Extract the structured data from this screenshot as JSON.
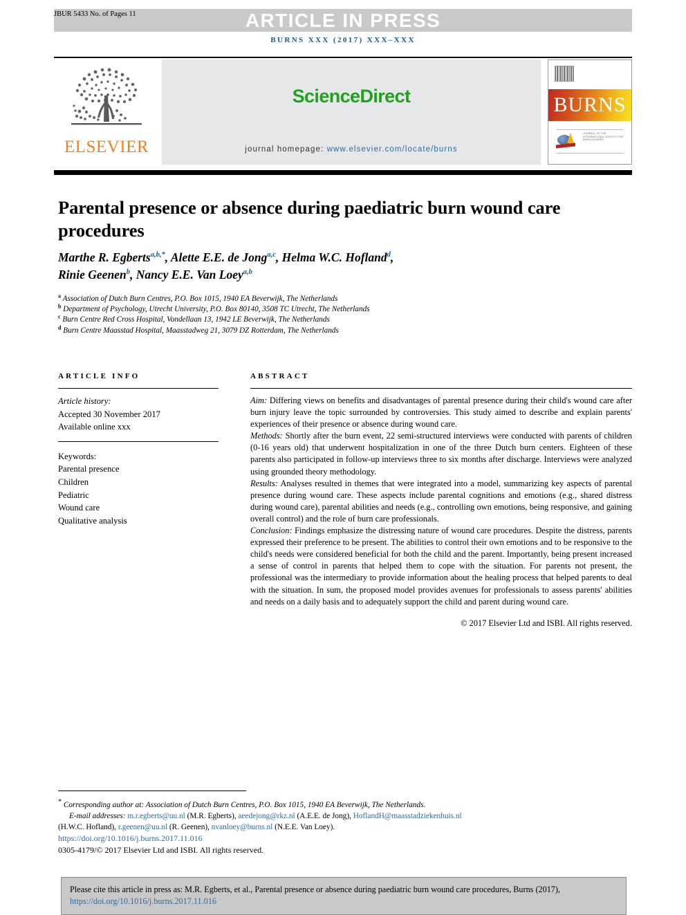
{
  "header": {
    "jbur_id": "JBUR 5433 No. of Pages 11",
    "article_in_press": "ARTICLE IN PRESS",
    "journal_volume_line": "BURNS XXX (2017) XXX–XXX",
    "publisher_name": "ELSEVIER",
    "sciencedirect": "ScienceDirect",
    "homepage_label": "journal homepage:",
    "homepage_url": "www.elsevier.com/locate/burns",
    "cover_title": "BURNS",
    "cover_society_lines": [
      "JOURNAL OF THE",
      "INTERNATIONAL SOCIETY FOR",
      "BURN INJURIES"
    ]
  },
  "article": {
    "title": "Parental presence or absence during paediatric burn wound care procedures",
    "authors": [
      {
        "name": "Marthe R. Egberts",
        "sup": "a,b,*"
      },
      {
        "name": "Alette E.E. de Jong",
        "sup": "a,c"
      },
      {
        "name": "Helma W.C. Hofland",
        "sup": "d"
      },
      {
        "name": "Rinie Geenen",
        "sup": "b"
      },
      {
        "name": "Nancy E.E. Van Loey",
        "sup": "a,b"
      }
    ],
    "affiliations": [
      {
        "marker": "a",
        "text": "Association of Dutch Burn Centres, P.O. Box 1015, 1940 EA Beverwijk, The Netherlands"
      },
      {
        "marker": "b",
        "text": "Department of Psychology, Utrecht University, P.O. Box 80140, 3508 TC Utrecht, The Netherlands"
      },
      {
        "marker": "c",
        "text": "Burn Centre Red Cross Hospital, Vondellaan 13, 1942 LE Beverwijk, The Netherlands"
      },
      {
        "marker": "d",
        "text": "Burn Centre Maasstad Hospital, Maasstadweg 21, 3079 DZ Rotterdam, The Netherlands"
      }
    ]
  },
  "article_info": {
    "heading": "ARTICLE INFO",
    "history_label": "Article history:",
    "accepted": "Accepted 30 November 2017",
    "available": "Available online xxx",
    "keywords_label": "Keywords:",
    "keywords": [
      "Parental presence",
      "Children",
      "Pediatric",
      "Wound care",
      "Qualitative analysis"
    ]
  },
  "abstract": {
    "heading": "ABSTRACT",
    "aim_label": "Aim:",
    "aim_text": " Differing views on benefits and disadvantages of parental presence during their child's wound care after burn injury leave the topic surrounded by controversies. This study aimed to describe and explain parents' experiences of their presence or absence during wound care.",
    "methods_label": "Methods:",
    "methods_text": " Shortly after the burn event, 22 semi-structured interviews were conducted with parents of children (0-16 years old) that underwent hospitalization in one of the three Dutch burn centers. Eighteen of these parents also participated in follow-up interviews three to six months after discharge. Interviews were analyzed using grounded theory methodology.",
    "results_label": "Results:",
    "results_text": " Analyses resulted in themes that were integrated into a model, summarizing key aspects of parental presence during wound care. These aspects include parental cognitions and emotions (e.g., shared distress during wound care), parental abilities and needs (e.g., controlling own emotions, being responsive, and gaining overall control) and the role of burn care professionals.",
    "conclusion_label": "Conclusion:",
    "conclusion_text": " Findings emphasize the distressing nature of wound care procedures. Despite the distress, parents expressed their preference to be present. The abilities to control their own emotions and to be responsive to the child's needs were considered beneficial for both the child and the parent. Importantly, being present increased a sense of control in parents that helped them to cope with the situation. For parents not present, the professional was the intermediary to provide information about the healing process that helped parents to deal with the situation. In sum, the proposed model provides avenues for professionals to assess parents' abilities and needs on a daily basis and to adequately support the child and parent during wound care.",
    "copyright": "© 2017 Elsevier Ltd and ISBI. All rights reserved."
  },
  "footnotes": {
    "corresponding_marker": "*",
    "corresponding_text": "Corresponding author at: Association of Dutch Burn Centres, P.O. Box 1015, 1940 EA Beverwijk, The Netherlands.",
    "email_label": "E-mail addresses:",
    "emails": [
      {
        "address": "m.r.egberts@uu.nl",
        "owner": "(M.R. Egberts)"
      },
      {
        "address": "aeedejong@rkz.nl",
        "owner": "(A.E.E. de Jong)"
      },
      {
        "address": "HoflandH@maasstadziekenhuis.nl",
        "owner": "(H.W.C. Hofland)"
      },
      {
        "address": "r.geenen@uu.nl",
        "owner": "(R. Geenen)"
      },
      {
        "address": "nvanloey@burns.nl",
        "owner": "(N.E.E. Van Loey)"
      }
    ],
    "doi": "https://doi.org/10.1016/j.burns.2017.11.016",
    "issn_line": "0305-4179/© 2017 Elsevier Ltd and ISBI. All rights reserved."
  },
  "cite_box": {
    "text": "Please cite this article in press as: M.R. Egberts, et al., Parental presence or absence during paediatric burn wound care procedures, Burns (2017), ",
    "link": "https://doi.org/10.1016/j.burns.2017.11.016"
  },
  "colors": {
    "band_gray": "#c9c9c9",
    "journal_blue": "#17598c",
    "link_blue": "#2b6ca3",
    "elsevier_orange": "#f57f20",
    "sciencedirect_green": "#1fa01f",
    "panel_gray": "#e6e7e8"
  }
}
